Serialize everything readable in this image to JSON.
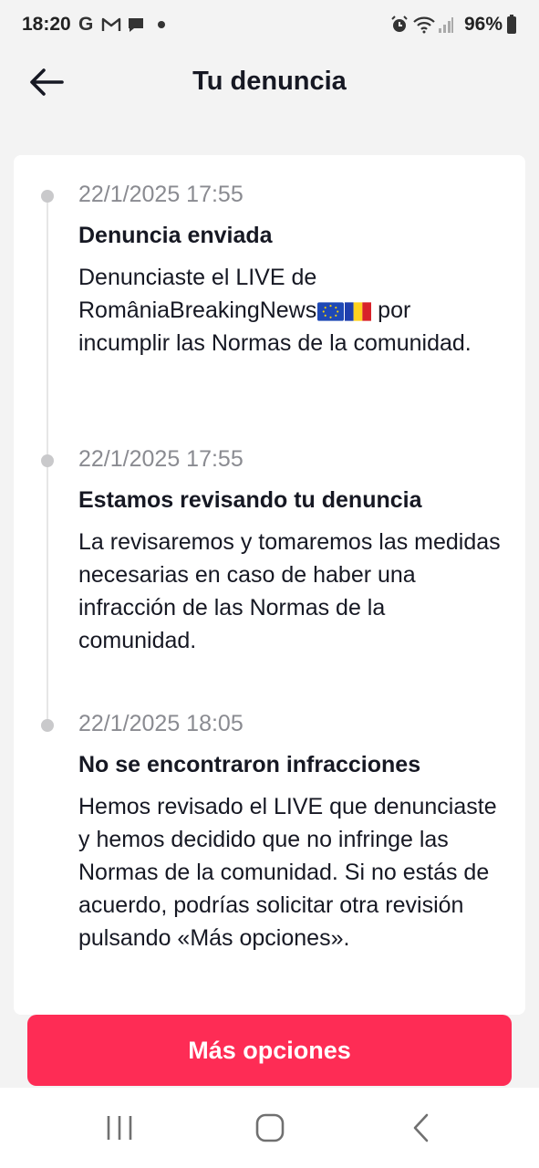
{
  "status_bar": {
    "time": "18:20",
    "battery": "96%",
    "icons": [
      "google-icon",
      "gmail-icon",
      "chat-icon",
      "dot-icon",
      "alarm-icon",
      "wifi-icon",
      "signal-icon",
      "battery-icon"
    ]
  },
  "header": {
    "title": "Tu denuncia",
    "back_icon": "arrow-left-icon"
  },
  "events": [
    {
      "date": "22/1/2025 17:55",
      "title": "Denuncia enviada",
      "body_before_flags": "Denunciaste el LIVE de RomâniaBreakingNews",
      "flags": [
        "eu-flag",
        "romania-flag"
      ],
      "body_after_flags": " por incumplir las Normas de la comunidad."
    },
    {
      "date": "22/1/2025 17:55",
      "title": "Estamos revisando tu denuncia",
      "body": "La revisaremos y tomaremos las medidas necesarias en caso de haber una infracción de las Normas de la comunidad."
    },
    {
      "date": "22/1/2025 18:05",
      "title": "No se encontraron infracciones",
      "body": "Hemos revisado el LIVE que denunciaste y hemos decidido que no infringe las Normas de la comunidad. Si no estás de acuerdo, podrías solicitar otra revisión pulsando «Más opciones»."
    }
  ],
  "more_button": {
    "label": "Más opciones"
  },
  "nav_bar": {
    "buttons": [
      "recents-icon",
      "home-icon",
      "back-icon"
    ]
  },
  "colors": {
    "accent": "#fe2c55",
    "background": "#f3f3f3",
    "card": "#ffffff",
    "date_text": "#8a8b91",
    "timeline": "#c9c9cb"
  }
}
